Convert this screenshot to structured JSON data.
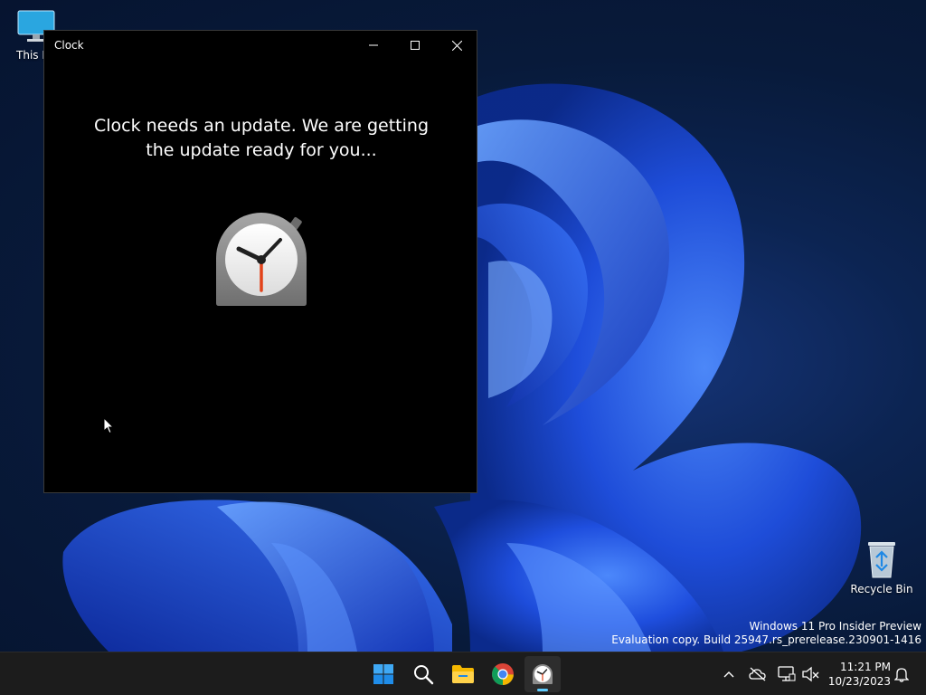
{
  "desktop": {
    "icons": [
      {
        "label": "This PC",
        "icon": "monitor-icon"
      },
      {
        "label": "Recycle Bin",
        "icon": "recycle-bin-icon"
      }
    ],
    "watermark": {
      "line1": "Windows 11 Pro Insider Preview",
      "line2": "Evaluation copy. Build 25947.rs_prerelease.230901-1416"
    }
  },
  "window": {
    "title": "Clock",
    "message": "Clock needs an update. We are getting the update ready for you...",
    "logo": "clock-app-icon",
    "controls": [
      "minimize-icon",
      "maximize-icon",
      "close-icon"
    ]
  },
  "taskbar": {
    "apps": [
      {
        "name": "Start",
        "icon": "windows-logo-icon"
      },
      {
        "name": "Search",
        "icon": "search-icon"
      },
      {
        "name": "File Explorer",
        "icon": "folder-icon"
      },
      {
        "name": "Google Chrome",
        "icon": "chrome-icon"
      },
      {
        "name": "Clock",
        "icon": "clock-icon",
        "active": true
      }
    ],
    "tray": {
      "icons": [
        "chevron-up-icon",
        "onedrive-offline-icon",
        "network-icon",
        "volume-muted-icon"
      ],
      "time": "11:21 PM",
      "date": "10/23/2023",
      "notification_icon": "bell-icon"
    }
  },
  "colors": {
    "accent": "#60cdff",
    "taskbar": "#1c1c1c",
    "window_bg": "#000000"
  }
}
